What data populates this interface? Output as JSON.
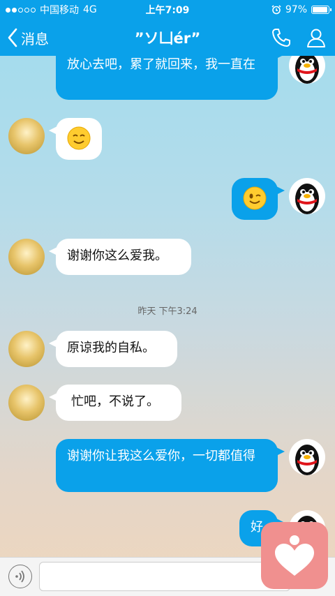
{
  "status": {
    "carrier": "中国移动",
    "network": "4G",
    "time": "上午7:09",
    "battery": "97%",
    "battery_level": 0.97
  },
  "nav": {
    "back_label": "消息",
    "title": "”ソ凵ér”"
  },
  "messages": [
    {
      "side": "right",
      "text": "放心去吧，累了就回来，我一直在"
    },
    {
      "side": "left",
      "emoji": "smile-emoji"
    },
    {
      "side": "right",
      "emoji": "wink-emoji"
    },
    {
      "side": "left",
      "text": "谢谢你这么爱我。"
    },
    {
      "side": "left",
      "text": "原谅我的自私。"
    },
    {
      "side": "left",
      "text": "忙吧，不说了。"
    },
    {
      "side": "right",
      "text": "谢谢你让我这么爱你，一切都值得"
    },
    {
      "side": "right",
      "text": "好"
    }
  ],
  "timestamp": "昨天 下午3:24",
  "input": {
    "placeholder": ""
  },
  "icons": [
    "back-chevron-icon",
    "phone-icon",
    "profile-icon",
    "voice-icon",
    "heart-icon"
  ],
  "colors": {
    "accent": "#0aa1ea",
    "watermark": "#f0908f"
  }
}
